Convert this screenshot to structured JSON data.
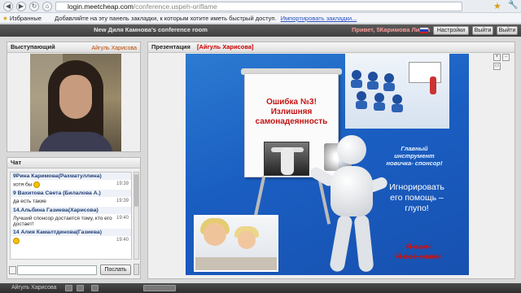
{
  "browser": {
    "url_host": "login.meetcheap.com",
    "url_path": "/conference.uspeh-oriflame",
    "bookmarks_label": "Избранные",
    "bookmarks_hint": "Добавляйте на эту панель закладки, к которым хотите иметь быстрый доступ.",
    "bookmarks_import_link": "Импортировать закладки..."
  },
  "appbar": {
    "room_title": "New Диля Камнова's conference room",
    "greeting": "Привет, 5Каримова Лиана",
    "settings_label": "Настройки",
    "exit_label": "Выйти",
    "exit2_label": "Выйти",
    "flag_colors": [
      "#ffffff",
      "#1f3fbf",
      "#d01c1c"
    ]
  },
  "presenter": {
    "title": "Выступающий",
    "name": "Айгуль Харисова"
  },
  "presentation": {
    "title": "Презентация",
    "presenter_name": "[Айгуль Харисова]"
  },
  "slide": {
    "title_line1": "Ошибка №3!",
    "title_line2": "Излишняя",
    "title_line3": "самонадеянность",
    "mentor_line1": "Главный",
    "mentor_line2": "инструмент",
    "mentor_line3": "новичка- спонсор!",
    "ignore_line1": "Игнорировать",
    "ignore_line2": "его помощь –",
    "ignore_line3": "глупо!",
    "self_line1": "Я сам!",
    "self_line2": "Я всё знаю!"
  },
  "chat": {
    "title": "Чат",
    "messages": [
      {
        "author": "9Рина Каримова(Рахматуллина)",
        "text": "хотя бы",
        "time": "19:39",
        "smiley": true
      },
      {
        "author": "9 Вахитова Света (Билалова А.)",
        "text": "да есть такие",
        "time": "19:39",
        "smiley": false
      },
      {
        "author": "14.Альбина Газиева(Харисова)",
        "text": "Лучший спонсор достается тому, кто его достает!",
        "time": "19:40",
        "smiley": false
      },
      {
        "author": "14 Алия Камалтдинова(Газиева)",
        "text": "",
        "time": "19:40",
        "smiley": true
      }
    ],
    "send_label": "Послать",
    "input_value": ""
  },
  "bottom": {
    "user_name": "Айгуль Харисова"
  }
}
